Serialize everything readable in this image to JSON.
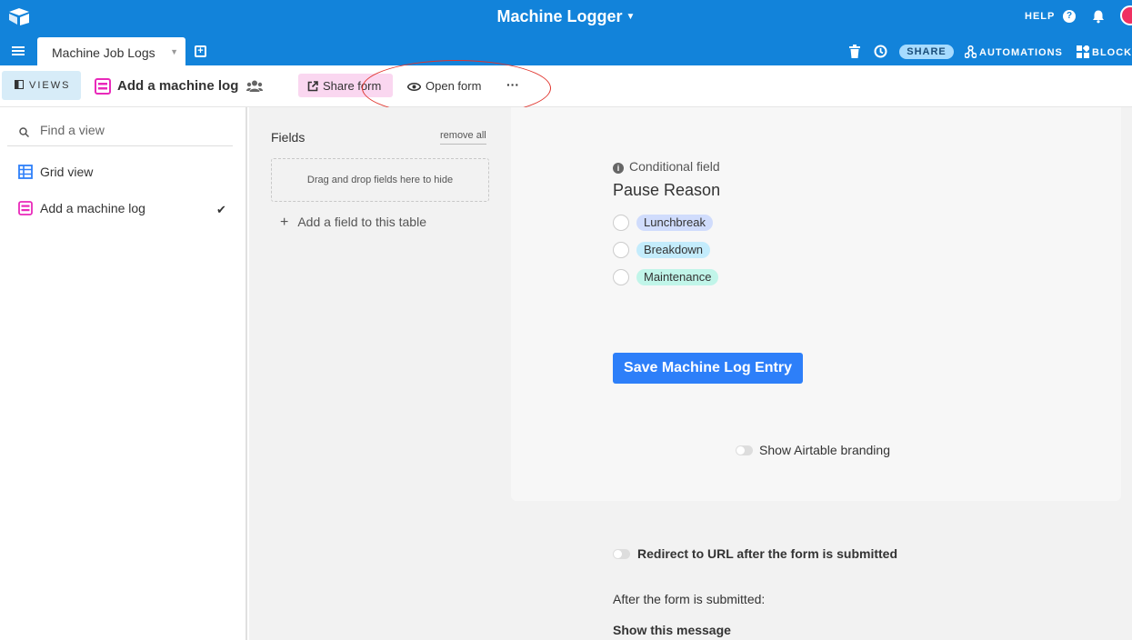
{
  "header": {
    "app_title": "Machine Logger",
    "help_label": "HELP",
    "help_icon_glyph": "?",
    "share_label": "SHARE",
    "automations_label": "AUTOMATIONS",
    "blocks_label": "BLOCKS",
    "colors": {
      "bar": "#1283da",
      "avatar": "#ef3061"
    }
  },
  "tabs": [
    {
      "label": "Machine Job Logs",
      "active": true
    }
  ],
  "viewbar": {
    "views_label": "VIEWS",
    "current_view": "Add a machine log",
    "share_form_label": "Share form",
    "open_form_label": "Open form",
    "more_label": "···"
  },
  "sidebar": {
    "search_placeholder": "Find a view",
    "items": [
      {
        "label": "Grid view",
        "icon": "grid-view-icon",
        "color": "#2d7ff9",
        "selected": false
      },
      {
        "label": "Add a machine log",
        "icon": "form-view-icon",
        "color": "#e929ba",
        "selected": true
      }
    ]
  },
  "fields_panel": {
    "title": "Fields",
    "remove_all_label": "remove all",
    "drop_zone_text": "Drag and drop fields here to hide",
    "add_field_label": "Add a field to this table"
  },
  "form": {
    "conditional_label": "Conditional field",
    "field_title": "Pause Reason",
    "options": [
      {
        "label": "Lunchbreak",
        "color": "#d0dcfc"
      },
      {
        "label": "Breakdown",
        "color": "#c4ecfc"
      },
      {
        "label": "Maintenance",
        "color": "#c1f5e9"
      }
    ],
    "submit_label": "Save Machine Log Entry",
    "branding_label": "Show Airtable branding",
    "branding_on": false
  },
  "after_submit": {
    "redirect_label": "Redirect to URL after the form is submitted",
    "redirect_on": false,
    "after_label": "After the form is submitted:",
    "show_message_label": "Show this message"
  }
}
